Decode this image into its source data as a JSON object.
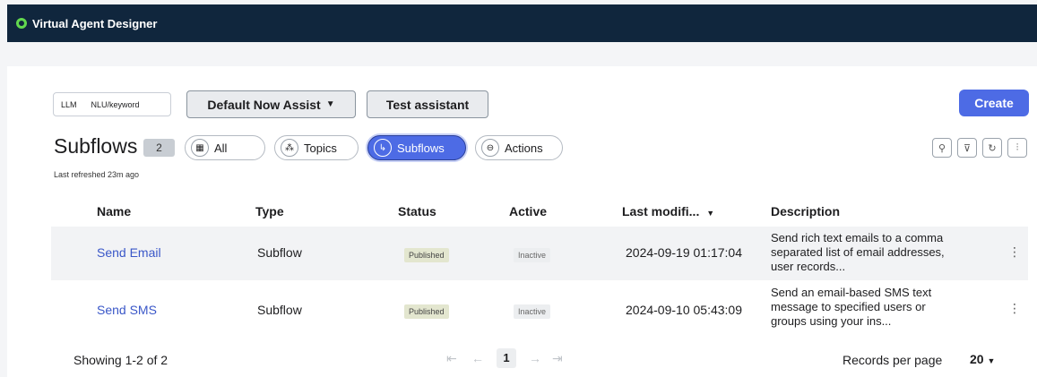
{
  "app": {
    "title": "Virtual Agent Designer"
  },
  "toolbar": {
    "mode_options": [
      "LLM",
      "NLU/keyword"
    ],
    "assistant_select": "Default Now Assist",
    "test_button": "Test assistant",
    "create_button": "Create"
  },
  "page": {
    "title": "Subflows",
    "count": "2",
    "last_refreshed": "Last refreshed 23m ago"
  },
  "filters": [
    {
      "label": "All",
      "icon": "grid-icon"
    },
    {
      "label": "Topics",
      "icon": "topics-icon"
    },
    {
      "label": "Subflows",
      "icon": "subflow-icon"
    },
    {
      "label": "Actions",
      "icon": "action-icon"
    }
  ],
  "table": {
    "columns": [
      "Name",
      "Type",
      "Status",
      "Active",
      "Last modifi...",
      "Description"
    ],
    "rows": [
      {
        "name": "Send Email",
        "type": "Subflow",
        "status": "Published",
        "active": "Inactive",
        "modified": "2024-09-19 01:17:04",
        "description": "Send rich text emails to a comma separated list of email addresses, user records..."
      },
      {
        "name": "Send SMS",
        "type": "Subflow",
        "status": "Published",
        "active": "Inactive",
        "modified": "2024-09-10 05:43:09",
        "description": "Send an email-based SMS text message to specified users or groups using your ins..."
      }
    ]
  },
  "footer": {
    "showing": "Showing 1-2 of 2",
    "current_page": "1",
    "records_label": "Records per page",
    "records_value": "20"
  },
  "colors": {
    "brand": "#10263d",
    "accent": "#4d6be5",
    "logo": "#62d84e"
  }
}
